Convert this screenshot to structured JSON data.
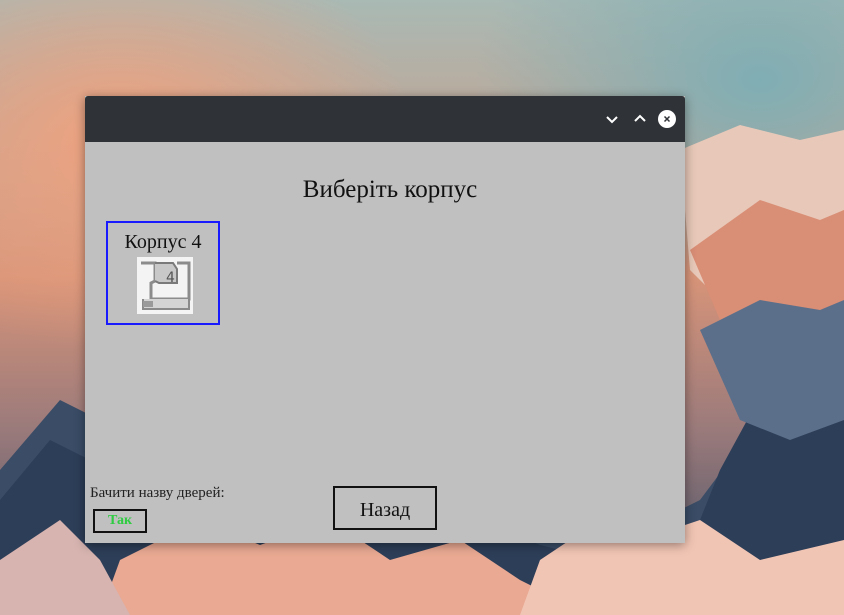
{
  "window": {
    "controls": {
      "minimize_icon": "chevron-down-icon",
      "maximize_icon": "chevron-up-icon",
      "close_icon": "close-icon"
    }
  },
  "main": {
    "title": "Виберіть корпус",
    "buildings": [
      {
        "label": "Корпус 4",
        "image_icon": "building-4-plan-icon"
      }
    ],
    "door_names": {
      "label": "Бачити назву дверей:",
      "toggle_value": "Так",
      "toggle_color": "#2ecc40"
    },
    "back_button": "Назад"
  },
  "colors": {
    "titlebar": "#2f3337",
    "window_bg": "#c0c0c0",
    "selection_border": "#1a1aff"
  }
}
